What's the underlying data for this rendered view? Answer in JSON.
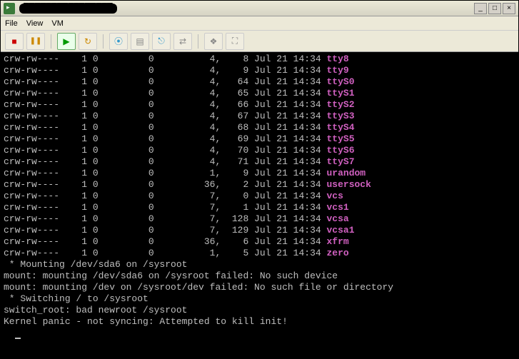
{
  "window": {
    "title_redacted": "████████████████",
    "controls": {
      "minimize": "_",
      "maximize": "□",
      "close": "×"
    }
  },
  "menu": {
    "file": "File",
    "view": "View",
    "vm": "VM"
  },
  "toolbar": {
    "stop": "■",
    "pause": "❚❚",
    "play": "▶",
    "refresh": "↻",
    "cd": "⦿",
    "floppy": "▤",
    "usb": "⎋",
    "net": "⇄",
    "snap": "❖",
    "full": "⛶"
  },
  "listing": [
    {
      "perm": "crw-rw----",
      "links": "1",
      "owner": "0",
      "group": "0",
      "maj": "4,",
      "min": "8",
      "date": "Jul 21 14:34",
      "name": "tty8"
    },
    {
      "perm": "crw-rw----",
      "links": "1",
      "owner": "0",
      "group": "0",
      "maj": "4,",
      "min": "9",
      "date": "Jul 21 14:34",
      "name": "tty9"
    },
    {
      "perm": "crw-rw----",
      "links": "1",
      "owner": "0",
      "group": "0",
      "maj": "4,",
      "min": "64",
      "date": "Jul 21 14:34",
      "name": "ttyS0"
    },
    {
      "perm": "crw-rw----",
      "links": "1",
      "owner": "0",
      "group": "0",
      "maj": "4,",
      "min": "65",
      "date": "Jul 21 14:34",
      "name": "ttyS1"
    },
    {
      "perm": "crw-rw----",
      "links": "1",
      "owner": "0",
      "group": "0",
      "maj": "4,",
      "min": "66",
      "date": "Jul 21 14:34",
      "name": "ttyS2"
    },
    {
      "perm": "crw-rw----",
      "links": "1",
      "owner": "0",
      "group": "0",
      "maj": "4,",
      "min": "67",
      "date": "Jul 21 14:34",
      "name": "ttyS3"
    },
    {
      "perm": "crw-rw----",
      "links": "1",
      "owner": "0",
      "group": "0",
      "maj": "4,",
      "min": "68",
      "date": "Jul 21 14:34",
      "name": "ttyS4"
    },
    {
      "perm": "crw-rw----",
      "links": "1",
      "owner": "0",
      "group": "0",
      "maj": "4,",
      "min": "69",
      "date": "Jul 21 14:34",
      "name": "ttyS5"
    },
    {
      "perm": "crw-rw----",
      "links": "1",
      "owner": "0",
      "group": "0",
      "maj": "4,",
      "min": "70",
      "date": "Jul 21 14:34",
      "name": "ttyS6"
    },
    {
      "perm": "crw-rw----",
      "links": "1",
      "owner": "0",
      "group": "0",
      "maj": "4,",
      "min": "71",
      "date": "Jul 21 14:34",
      "name": "ttyS7"
    },
    {
      "perm": "crw-rw----",
      "links": "1",
      "owner": "0",
      "group": "0",
      "maj": "1,",
      "min": "9",
      "date": "Jul 21 14:34",
      "name": "urandom"
    },
    {
      "perm": "crw-rw----",
      "links": "1",
      "owner": "0",
      "group": "0",
      "maj": "36,",
      "min": "2",
      "date": "Jul 21 14:34",
      "name": "usersock"
    },
    {
      "perm": "crw-rw----",
      "links": "1",
      "owner": "0",
      "group": "0",
      "maj": "7,",
      "min": "0",
      "date": "Jul 21 14:34",
      "name": "vcs"
    },
    {
      "perm": "crw-rw----",
      "links": "1",
      "owner": "0",
      "group": "0",
      "maj": "7,",
      "min": "1",
      "date": "Jul 21 14:34",
      "name": "vcs1"
    },
    {
      "perm": "crw-rw----",
      "links": "1",
      "owner": "0",
      "group": "0",
      "maj": "7,",
      "min": "128",
      "date": "Jul 21 14:34",
      "name": "vcsa"
    },
    {
      "perm": "crw-rw----",
      "links": "1",
      "owner": "0",
      "group": "0",
      "maj": "7,",
      "min": "129",
      "date": "Jul 21 14:34",
      "name": "vcsa1"
    },
    {
      "perm": "crw-rw----",
      "links": "1",
      "owner": "0",
      "group": "0",
      "maj": "36,",
      "min": "6",
      "date": "Jul 21 14:34",
      "name": "xfrm"
    },
    {
      "perm": "crw-rw----",
      "links": "1",
      "owner": "0",
      "group": "0",
      "maj": "1,",
      "min": "5",
      "date": "Jul 21 14:34",
      "name": "zero"
    }
  ],
  "messages": [
    " * Mounting /dev/sda6 on /sysroot",
    "mount: mounting /dev/sda6 on /sysroot failed: No such device",
    "mount: mounting /dev on /sysroot/dev failed: No such file or directory",
    " * Switching / to /sysroot",
    "switch_root: bad newroot /sysroot",
    "Kernel panic - not syncing: Attempted to kill init!"
  ]
}
